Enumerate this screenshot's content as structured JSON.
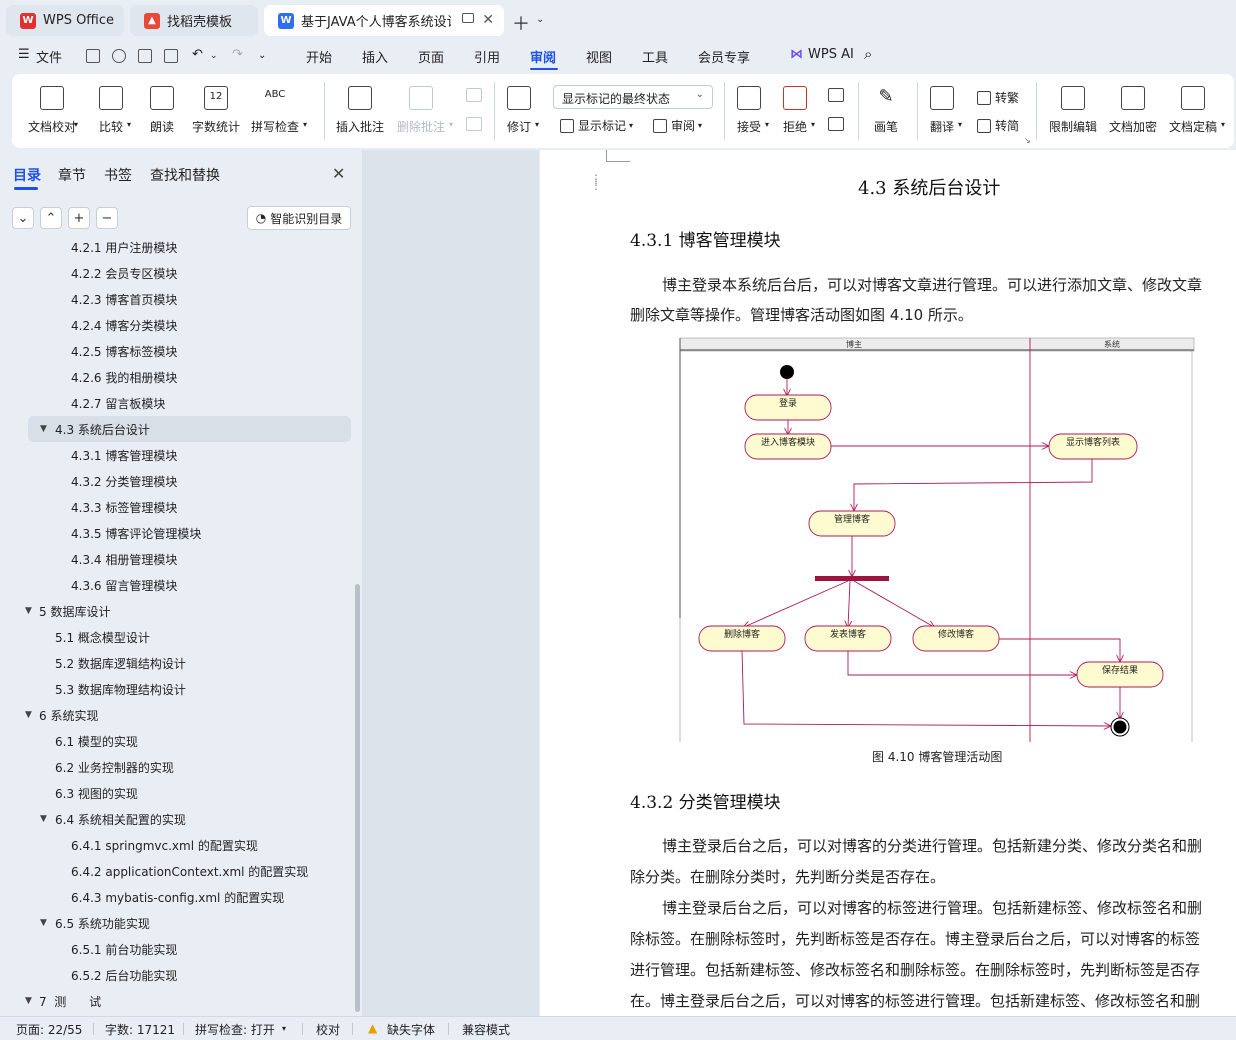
{
  "tabs": [
    {
      "label": "WPS Office"
    },
    {
      "label": "找稻壳模板"
    },
    {
      "label": "基于JAVA个人博客系统设计与"
    }
  ],
  "menubar": {
    "file": "文件",
    "items": [
      "开始",
      "插入",
      "页面",
      "引用",
      "审阅",
      "视图",
      "工具",
      "会员专享"
    ],
    "ai": "WPS AI"
  },
  "ribbon": {
    "doc_check": "文档校对",
    "compare": "比较",
    "read_aloud": "朗读",
    "word_count": "字数统计",
    "spell_check": "拼写检查",
    "insert_comment": "插入批注",
    "delete_comment": "删除批注",
    "revise": "修订",
    "markup_state": "显示标记的最终状态",
    "show_markup": "显示标记",
    "review": "审阅",
    "accept": "接受",
    "reject": "拒绝",
    "pen": "画笔",
    "translate": "翻译",
    "to_traditional": "转繁",
    "to_simplified": "转简",
    "restrict_edit": "限制编辑",
    "encrypt": "文档加密",
    "finalize": "文档定稿",
    "count_icon_text": "12",
    "abc_icon_text": "ABC"
  },
  "sidebar": {
    "tabs": [
      "目录",
      "章节",
      "书签",
      "查找和替换"
    ],
    "smart_button": "智能识别目录",
    "toc": [
      {
        "text": "4.2.1  用户注册模块"
      },
      {
        "text": "4.2.2  会员专区模块"
      },
      {
        "text": "4.2.3  博客首页模块"
      },
      {
        "text": "4.2.4  博客分类模块"
      },
      {
        "text": "4.2.5  博客标签模块"
      },
      {
        "text": "4.2.6  我的相册模块"
      },
      {
        "text": "4.2.7  留言板模块"
      },
      {
        "text": "4.3  系统后台设计"
      },
      {
        "text": "4.3.1  博客管理模块"
      },
      {
        "text": "4.3.2  分类管理模块"
      },
      {
        "text": "4.3.3  标签管理模块"
      },
      {
        "text": "4.3.5  博客评论管理模块"
      },
      {
        "text": "4.3.4  相册管理模块"
      },
      {
        "text": "4.3.6  留言管理模块"
      },
      {
        "text": "5  数据库设计"
      },
      {
        "text": "5.1  概念模型设计"
      },
      {
        "text": "5.2  数据库逻辑结构设计"
      },
      {
        "text": "5.3  数据库物理结构设计"
      },
      {
        "text": "6  系统实现"
      },
      {
        "text": "6.1  模型的实现"
      },
      {
        "text": "6.2  业务控制器的实现"
      },
      {
        "text": "6.3  视图的实现"
      },
      {
        "text": "6.4  系统相关配置的实现"
      },
      {
        "text": "6.4.1 springmvc.xml 的配置实现"
      },
      {
        "text": "6.4.2 applicationContext.xml 的配置实现"
      },
      {
        "text": "6.4.3 mybatis-config.xml 的配置实现"
      },
      {
        "text": "6.5  系统功能实现"
      },
      {
        "text": "6.5.1  前台功能实现"
      },
      {
        "text": "6.5.2  后台功能实现"
      },
      {
        "text": "7  测      试"
      }
    ]
  },
  "document": {
    "h1": "4.3  系统后台设计",
    "h2_1": "4.3.1  博客管理模块",
    "p1_l1": "博主登录本系统后台后，可以对博客文章进行管理。可以进行添加文章、修改文章",
    "p1_l2": "删除文章等操作。管理博客活动图如图 4.10 所示。",
    "diagram": {
      "lane1": "博主",
      "lane2": "系统",
      "login": "登录",
      "enter": "进入博客模块",
      "show_list": "显示博客列表",
      "manage": "管理博客",
      "delete": "删除博客",
      "publish": "发表博客",
      "modify": "修改博客",
      "save": "保存结果"
    },
    "caption": "图 4.10  博客管理活动图",
    "h2_2": "4.3.2  分类管理模块",
    "p2_l1": "博主登录后台之后，可以对博客的分类进行管理。包括新建分类、修改分类名和删",
    "p2_l2": "除分类。在删除分类时，先判断分类是否存在。",
    "p3_l1": "博主登录后台之后，可以对博客的标签进行管理。包括新建标签、修改标签名和删",
    "p3_l2": "除标签。在删除标签时，先判断标签是否存在。博主登录后台之后，可以对博客的标签",
    "p3_l3": "进行管理。包括新建标签、修改标签名和删除标签。在删除标签时，先判断标签是否存",
    "p3_l4": "在。博主登录后台之后，可以对博客的标签进行管理。包括新建标签、修改标签名和删"
  },
  "status": {
    "page": "页面: 22/55",
    "words": "字数: 17121",
    "spell": "拼写检查: 打开",
    "proof": "校对",
    "missing_font": "缺失字体",
    "compat": "兼容模式"
  },
  "colors": {
    "accent": "#1d52e6",
    "diagram_line": "#b0195a",
    "node_fill": "#fffbd0"
  }
}
